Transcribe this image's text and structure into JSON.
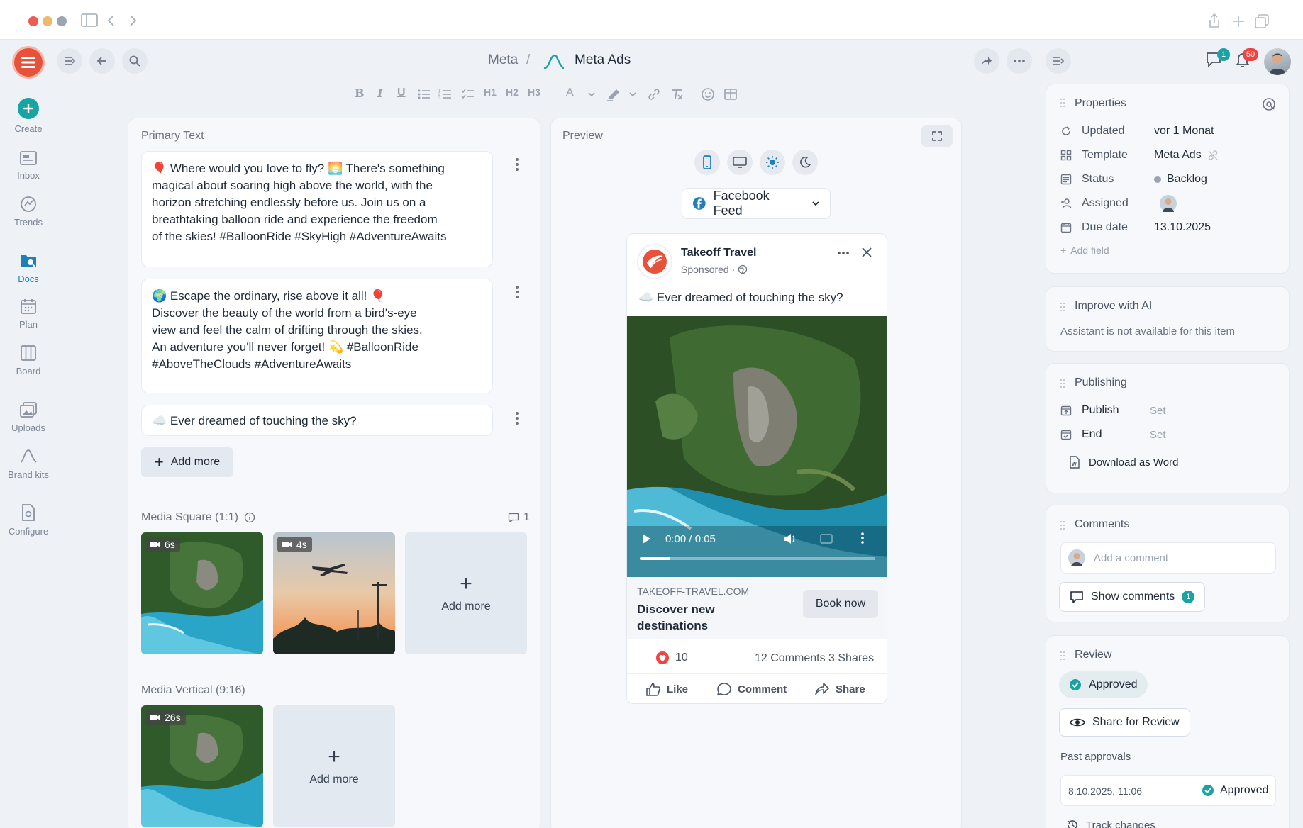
{
  "breadcrumb": {
    "parent": "Meta",
    "separator": "/",
    "current": "Meta Ads"
  },
  "notifications": {
    "chat_count": "1",
    "bell_count": "50"
  },
  "sidebar": {
    "items": [
      {
        "label": "Create"
      },
      {
        "label": "Inbox"
      },
      {
        "label": "Trends"
      },
      {
        "label": "Docs"
      },
      {
        "label": "Plan"
      },
      {
        "label": "Board"
      },
      {
        "label": "Uploads"
      },
      {
        "label": "Brand kits"
      },
      {
        "label": "Configure"
      }
    ]
  },
  "toolbar": {
    "h1": "H1",
    "h2": "H2",
    "h3": "H3",
    "bold": "B",
    "italic": "I",
    "underline": "U",
    "font_color": "A"
  },
  "editor": {
    "title": "Primary Text",
    "texts": [
      "🎈 Where would you love to fly? 🌅 There's something magical about soaring high above the world, with the horizon stretching endlessly before us. Join us on a breathtaking balloon ride and experience the freedom of the skies! #BalloonRide #SkyHigh #AdventureAwaits",
      "🌍 Escape the ordinary, rise above it all! 🎈 Discover the beauty of the world from a bird's-eye view and feel the calm of drifting through the skies. An adventure you'll never forget! 💫 #BalloonRide #AboveTheClouds #AdventureAwaits",
      "☁️ Ever dreamed of touching the sky?"
    ],
    "add_more": "Add more",
    "media_square": {
      "title": "Media Square (1:1)",
      "comment_count": "1",
      "items": [
        {
          "duration": "6s"
        },
        {
          "duration": "4s"
        }
      ],
      "add_more": "Add more"
    },
    "media_vertical": {
      "title": "Media Vertical (9:16)",
      "items": [
        {
          "duration": "26s"
        }
      ],
      "add_more": "Add more"
    }
  },
  "preview": {
    "title": "Preview",
    "feed_select": "Facebook Feed",
    "post": {
      "page_name": "Takeoff Travel",
      "sponsored": "Sponsored ·",
      "caption": "☁️ Ever dreamed of touching the sky?",
      "video_time": "0:00 / 0:05",
      "video_progress": 0.13,
      "domain": "TAKEOFF-TRAVEL.COM",
      "headline": "Discover new destinations",
      "cta": "Book now",
      "reactions": "10",
      "comments_shares": "12 Comments 3 Shares",
      "like": "Like",
      "comment": "Comment",
      "share": "Share"
    }
  },
  "properties": {
    "title": "Properties",
    "rows": [
      {
        "label": "Updated",
        "value": "vor 1 Monat"
      },
      {
        "label": "Template",
        "value": "Meta Ads"
      },
      {
        "label": "Status",
        "value": "Backlog"
      },
      {
        "label": "Assigned",
        "value": ""
      },
      {
        "label": "Due date",
        "value": "13.10.2025"
      }
    ],
    "add_field": "Add field"
  },
  "improve": {
    "title": "Improve with AI",
    "message": "Assistant is not available for this item"
  },
  "publishing": {
    "title": "Publishing",
    "publish_label": "Publish",
    "publish_value": "Set",
    "end_label": "End",
    "end_value": "Set",
    "download": "Download as Word"
  },
  "comments": {
    "title": "Comments",
    "placeholder": "Add a comment",
    "show": "Show comments",
    "count": "1"
  },
  "review": {
    "title": "Review",
    "status": "Approved",
    "share": "Share for Review",
    "past_title": "Past approvals",
    "past_date": "8.10.2025, 11:06",
    "past_status": "Approved",
    "track": "Track changes"
  },
  "colors": {
    "accent": "#1aa3a3",
    "brand": "#e8523a",
    "badge": "#ef4444",
    "cta_bg": "#e4e8ee"
  }
}
